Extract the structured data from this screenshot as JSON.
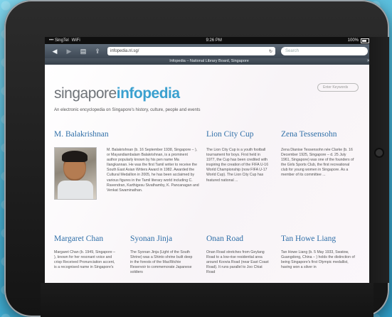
{
  "status": {
    "carrier": "••• SingTel",
    "wifi": "WiFi",
    "time": "9:26 PM",
    "battery": "100%"
  },
  "browser": {
    "url": "infopedia.nl.sg/",
    "search_placeholder": "Search",
    "page_title": "Infopedia – National Library Board, Singapore"
  },
  "site": {
    "logo_text": "singapore",
    "logo_accent": "infopedia",
    "tagline": "An electronic encyclopedia on Singapore's history, culture, people and events",
    "search_placeholder": "Enter Keywords"
  },
  "articles": [
    {
      "title": "M. Balakrishnan",
      "body": "M. Balakrishnan (b. 16 September 1938, Singapore – ), or Mayandiambalam Balakrishnan, is a prominent author popularly known by his pen name Ma Ilangkannan. He was the first Tamil writer to receive the South East Asian Writers Award in 1982. Awarded the Cultural Medallion in 2005, he has been acclaimed by various figures in the Tamil literary world including C. Ravendran, Karthigesu Sivathamby, K. Pancanagan and Venkat Swaminathan."
    },
    {
      "title": "Lion City Cup",
      "body": "The Lion City Cup is a youth football tournament for boys. First held in 1977, the Cup has been credited with inspiring the creation of the FIFA U-16 World Championship (now FIFA U-17 World Cup). The Lion City Cup has featured national ..."
    },
    {
      "title": "Zena Tessensohn",
      "body": "Zena Dianise Tessensohn née Clarke (b. 16 December 1925, Singapore – d. 25 July 1961, Singapore) was one of the founders of the Girls Sports Club, the first recreational club for young women in Singapore. As a member of its committee ..."
    },
    {
      "title": "Margaret Chan",
      "body": "Margaret Chan (b. 1949, Singapore – ), known for her resonant voice and crisp Received Pronunciation accent, is a recognised name in Singapore's"
    },
    {
      "title": "Syonan Jinja",
      "body": "The Syonan Jinja (Light of the South Shrine) was a Shinto shrine built deep in the forests of the MacRitchie Reservoir to commemorate Japanese soldiers"
    },
    {
      "title": "Onan Road",
      "body": "Onan Road stretches from Geylang Road to a low-rise residential area around Koovia Road (near East Coast Road). It runs parallel to Joo Chiat Road"
    },
    {
      "title": "Tan Howe Liang",
      "body": "Tan Howe Liang (b. 5 May 1933, Swatow, Guangdong, China – ) holds the distinction of being Singapore's first Olympic medallist, having won a silver in"
    }
  ]
}
